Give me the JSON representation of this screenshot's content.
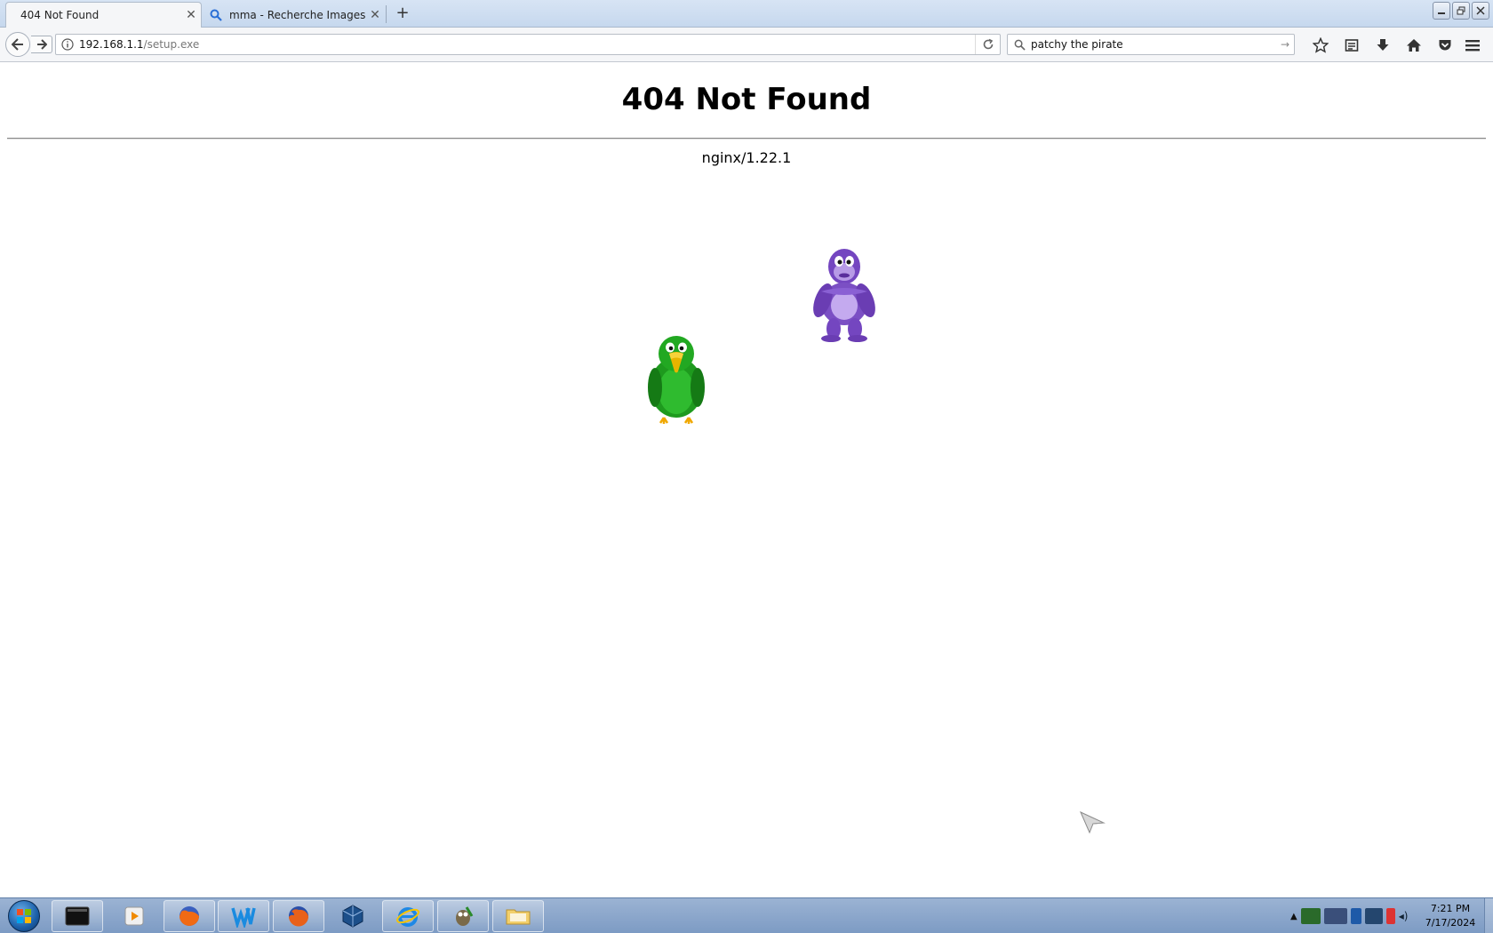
{
  "browser": {
    "tabs": [
      {
        "label": "404 Not Found",
        "active": true
      },
      {
        "label": "mma - Recherche Images",
        "active": false
      }
    ],
    "url": {
      "host": "192.168.1.1",
      "path": "/setup.exe"
    },
    "search": {
      "value": "patchy the pirate"
    }
  },
  "page": {
    "heading": "404 Not Found",
    "server": "nginx/1.22.1"
  },
  "taskbar": {
    "apps": [
      "terminal",
      "media-player",
      "firefox-old",
      "writer",
      "firefox",
      "virtualbox",
      "internet-explorer",
      "gimp",
      "file-manager"
    ],
    "clock": {
      "time": "7:21 PM",
      "date": "7/17/2024"
    }
  },
  "colors": {
    "tabstrip": "#c6d8ee",
    "taskbar": "#7d9bc4",
    "bonzi": "#7b4fc4",
    "parrot": "#1e9a1e"
  }
}
